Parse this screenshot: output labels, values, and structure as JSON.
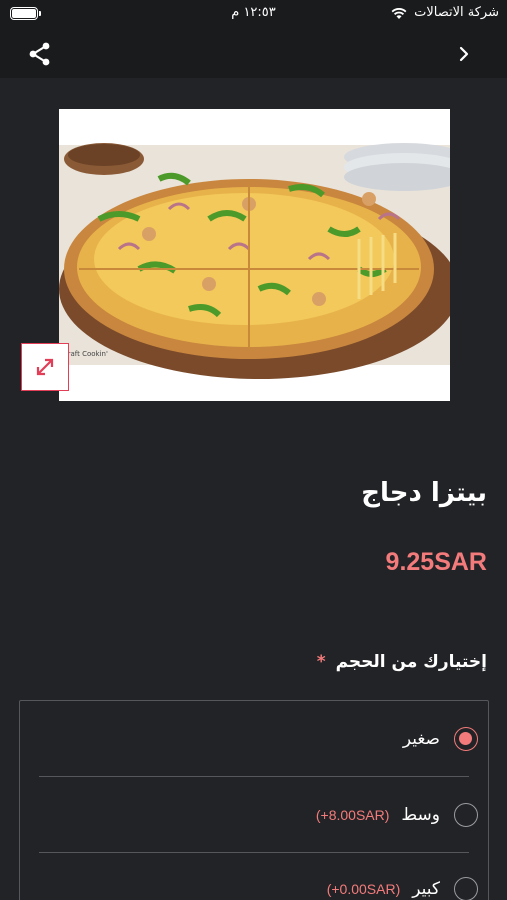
{
  "status_bar": {
    "carrier": "شركة الاتصالات",
    "time": "١٢:٥٣ م"
  },
  "nav": {
    "share_icon": "share-icon",
    "back_icon": "chevron-right-icon"
  },
  "product": {
    "title": "بيتزا دجاج",
    "price": "9.25SAR",
    "image_alt": "pizza-image"
  },
  "options": {
    "label": "إختيارك من الحجم",
    "required_mark": "*",
    "items": [
      {
        "label": "صغير",
        "extra": "",
        "selected": true
      },
      {
        "label": "وسط",
        "extra": "(+8.00SAR)",
        "selected": false
      },
      {
        "label": "كبير",
        "extra": "(+0.00SAR)",
        "selected": false
      }
    ]
  },
  "colors": {
    "background": "#222326",
    "bar": "#1a1b1d",
    "accent": "#f47b7b",
    "border": "#55575c"
  }
}
